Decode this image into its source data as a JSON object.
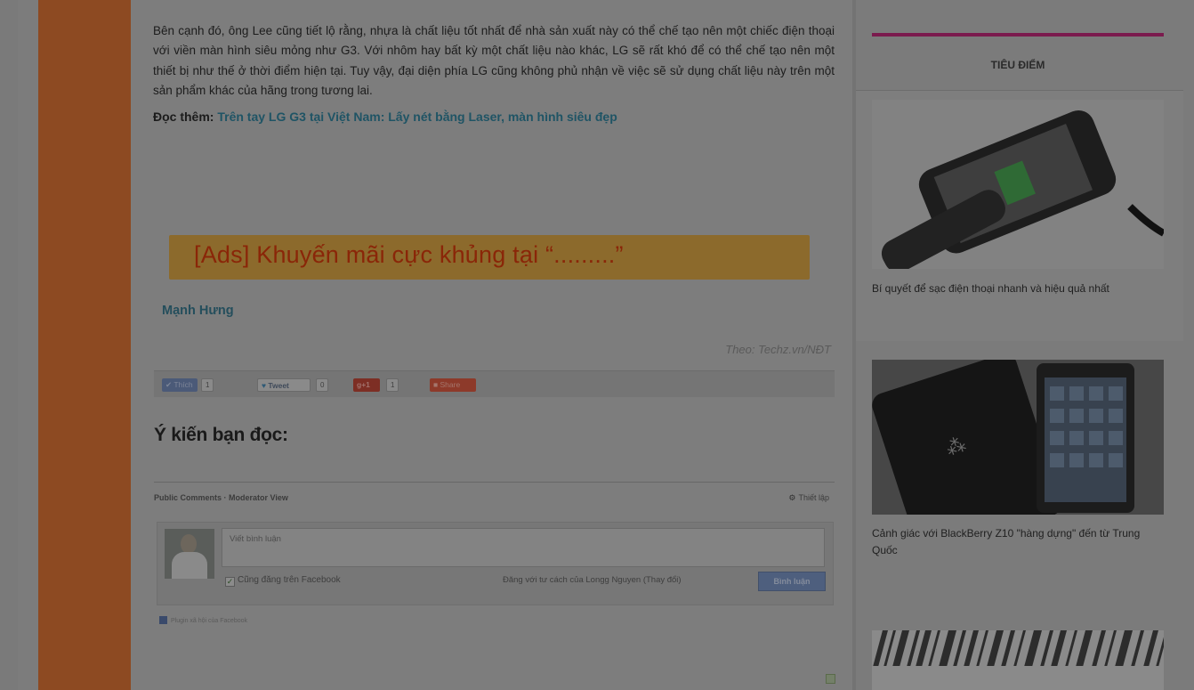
{
  "article": {
    "paragraph": "Bên cạnh đó, ông Lee cũng tiết lộ rằng, nhựa là chất liệu tốt nhất để nhà sản xuất này có thể chế tạo nên một chiếc điện thoại với viền màn hình siêu mỏng như G3. Với nhôm hay bất kỳ một chất liệu nào khác, LG sẽ rất khó để có thể chế tạo nên một thiết bị như thế ở thời điểm hiện tại. Tuy vậy, đại diện phía LG cũng không phủ nhận về việc sẽ sử dụng chất liệu này trên một sản phẩm khác của hãng trong tương lai.",
    "read_more_label": "Đọc thêm:",
    "read_more_link": "Trên tay LG G3 tại Việt Nam: Lấy nét bằng Laser, màn hình siêu đẹp",
    "ads_text": "[Ads] Khuyến mãi cực khủng tại “.........”",
    "author": "Mạnh Hưng",
    "source": "Theo: Techz.vn/NĐT"
  },
  "share": {
    "like_label": "Thích",
    "like_count": "1",
    "tweet_label": "Tweet",
    "tweet_count": "0",
    "gplus_label": "+1",
    "gplus_count": "1",
    "share_label": "Share"
  },
  "comments": {
    "title": "Ý kiến bạn đọc:",
    "header_label": "Public Comments · Moderator View",
    "settings_label": "Thiết lập",
    "input_placeholder": "Viết bình luận",
    "fb_checkbox_label": "Cũng đăng trên Facebook",
    "post_as_text": "Đăng với tư cách của Longg Nguyen (Thay đổi)",
    "post_button": "Bình luận",
    "plugin_note": "Plugin xã hội của Facebook"
  },
  "sidebar": {
    "section_title": "TIÊU ĐIỂM",
    "items": [
      {
        "caption": "Bí quyết để sạc điện thoại nhanh và hiệu quả nhất",
        "image": "iphone-charging-image"
      },
      {
        "caption": "Cảnh giác với BlackBerry Z10 \"hàng dựng\" đến từ Trung Quốc",
        "image": "blackberry-z10-image"
      },
      {
        "caption": "",
        "image": "barcode-image"
      }
    ]
  },
  "colors": {
    "overlay_dim": "#7c7c7c",
    "accent_orange_strip": "#8d4a22",
    "sidebar_accent": "#7b1b4e",
    "link": "#1f5465"
  }
}
